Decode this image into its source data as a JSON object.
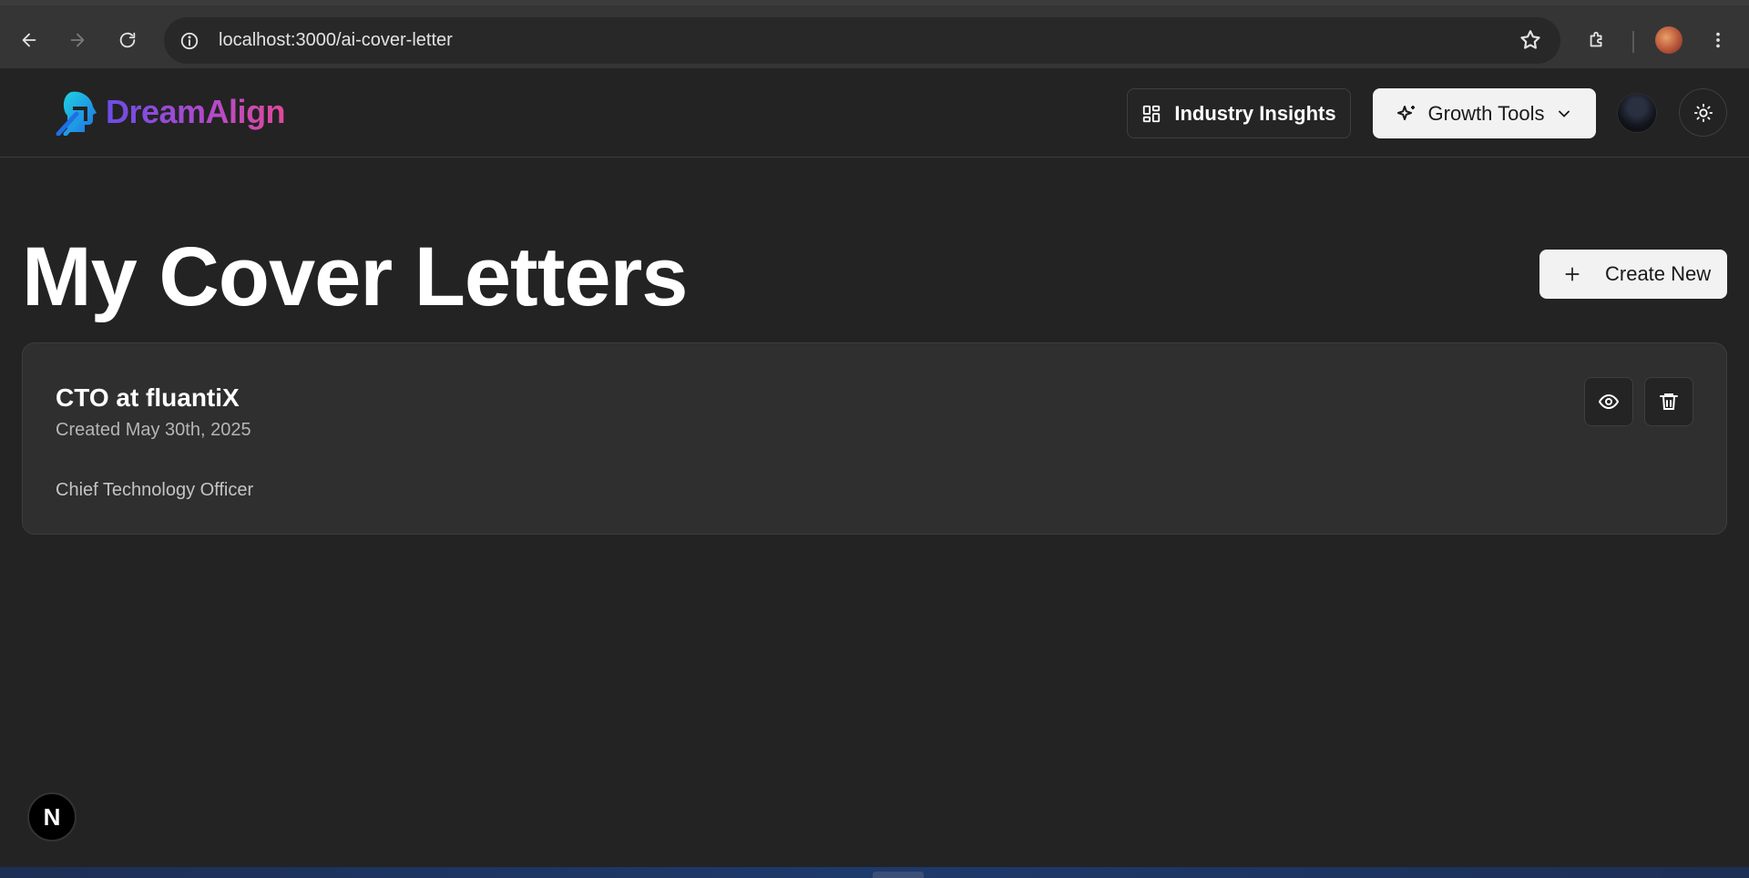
{
  "browser": {
    "url": "localhost:3000/ai-cover-letter"
  },
  "app": {
    "brand": "DreamAlign",
    "nav": {
      "industry_insights": "Industry Insights",
      "growth_tools": "Growth Tools"
    }
  },
  "page": {
    "title": "My Cover Letters",
    "create_label": "Create New"
  },
  "cover_letters": [
    {
      "title": "CTO at fluantiX",
      "created": "Created May 30th, 2025",
      "description": "Chief Technology Officer"
    }
  ],
  "dev_badge": "N",
  "colors": {
    "background": "#232323",
    "card": "#2f2f2f",
    "button_light": "#f2f2f2",
    "brand_start": "#6b4de6",
    "brand_end": "#e0499c",
    "logo_cyan": "#1fb5e6"
  }
}
